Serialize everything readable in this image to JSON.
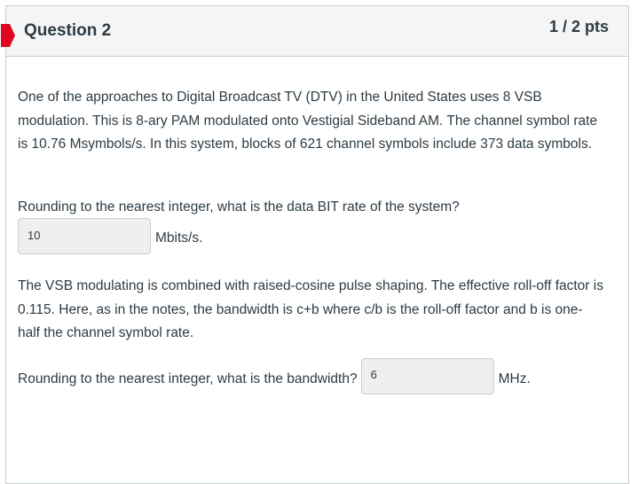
{
  "question": {
    "title": "Question 2",
    "points": "1 / 2 pts",
    "flag_color": "#e0061f"
  },
  "body": {
    "paragraph1": "One of the approaches to Digital Broadcast TV (DTV) in the United States uses 8 VSB modulation. This is 8-ary PAM modulated onto Vestigial Sideband AM. The channel symbol rate is 10.76 Msymbols/s.  In this system, blocks of 621 channel symbols include 373 data symbols.",
    "prompt1": "Rounding to the nearest integer, what is the data BIT rate of the system?",
    "answer1_value": "10",
    "answer1_unit": "Mbits/s.",
    "paragraph2": "The VSB modulating is combined with raised-cosine pulse shaping. The effective roll-off factor is 0.115. Here, as in the notes, the bandwidth is c+b where c/b is the roll-off factor and b is one-half the channel symbol rate.",
    "prompt2": "Rounding to the nearest integer, what is the bandwidth?",
    "answer2_value": "6",
    "answer2_unit": "MHz."
  }
}
